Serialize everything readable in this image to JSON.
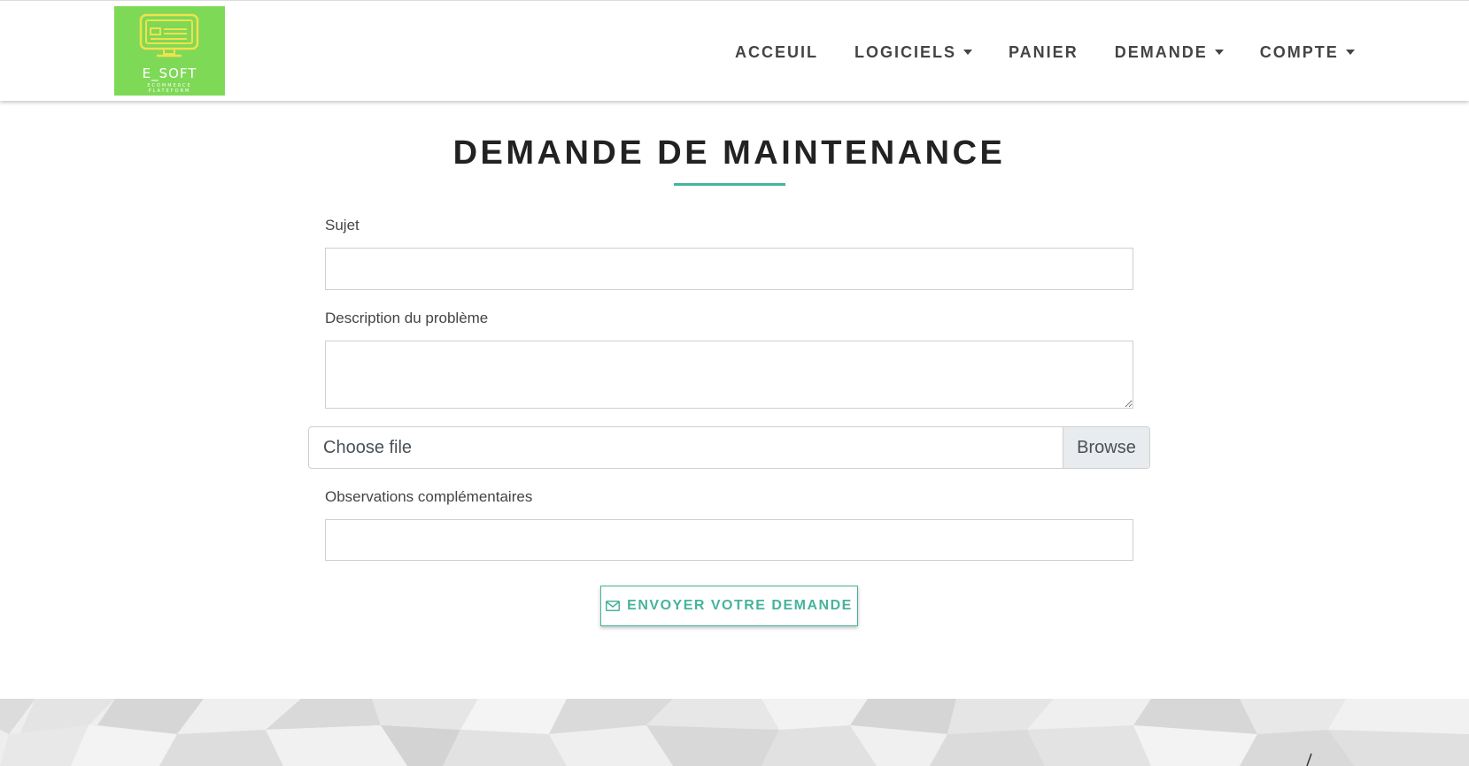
{
  "logo": {
    "title": "E_SOFT",
    "subtitle_line1": "ECOMMERCE",
    "subtitle_line2": "PLATEFORM",
    "background": "#7ed957",
    "icon": "monitor-icon"
  },
  "nav": {
    "items": [
      {
        "label": "ACCEUIL",
        "dropdown": false
      },
      {
        "label": "LOGICIELS",
        "dropdown": true
      },
      {
        "label": "PANIER",
        "dropdown": false
      },
      {
        "label": "DEMANDE",
        "dropdown": true
      },
      {
        "label": "COMPTE",
        "dropdown": true
      }
    ]
  },
  "page": {
    "title": "DEMANDE DE MAINTENANCE",
    "accent_color": "#47b39d"
  },
  "form": {
    "subject_label": "Sujet",
    "subject_value": "",
    "description_label": "Description du problème",
    "description_value": "",
    "file_placeholder": "Choose file",
    "file_button": "Browse",
    "observations_label": "Observations complémentaires",
    "observations_value": "",
    "submit_label": "ENVOYER VOTRE DEMANDE",
    "submit_icon": "envelope-icon"
  }
}
